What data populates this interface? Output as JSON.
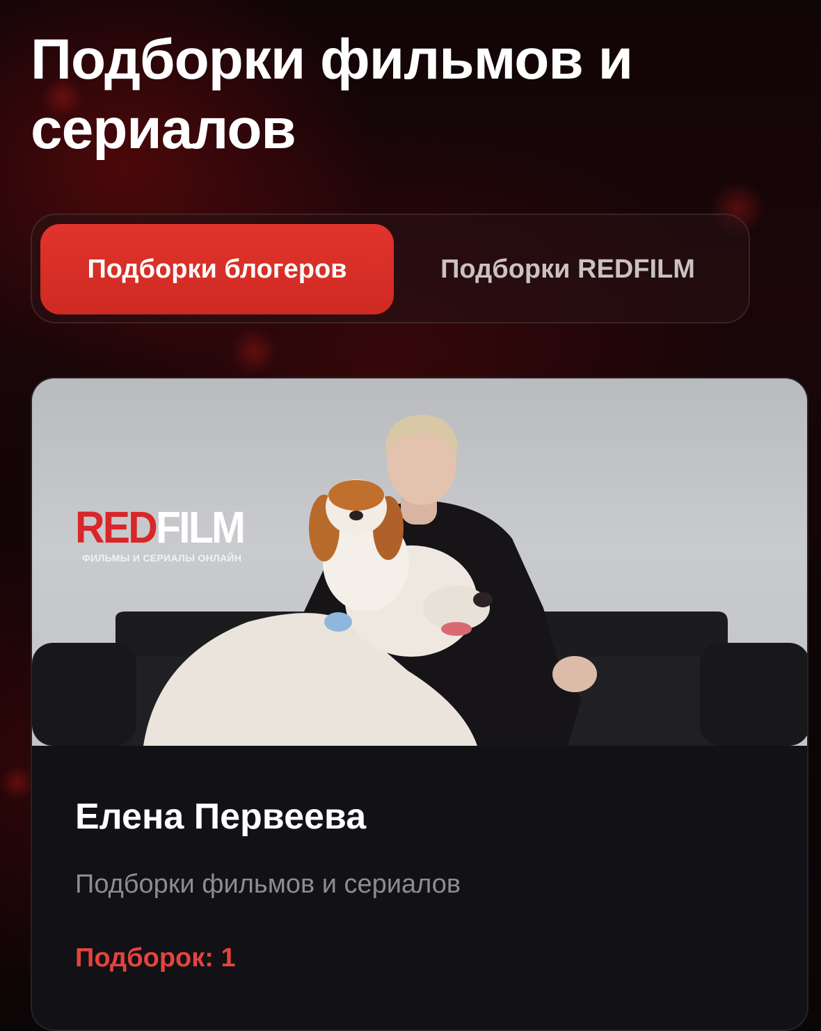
{
  "page": {
    "title": "Подборки фильмов и сериалов"
  },
  "tabs": [
    {
      "label": "Подборки блогеров",
      "active": true
    },
    {
      "label": "Подборки REDFILM",
      "active": false
    }
  ],
  "collection_card": {
    "image": {
      "logo_red": "RED",
      "logo_white": "FILM",
      "logo_tagline": "ФИЛЬМЫ И СЕРИАЛЫ ОНЛАЙН"
    },
    "name": "Елена Первеева",
    "description": "Подборки фильмов и сериалов",
    "count_text": "Подборок: 1"
  },
  "colors": {
    "accent": "#d8302a",
    "count_text": "#e4443e",
    "card_background": "#121116",
    "muted_text": "#8e8c93"
  }
}
